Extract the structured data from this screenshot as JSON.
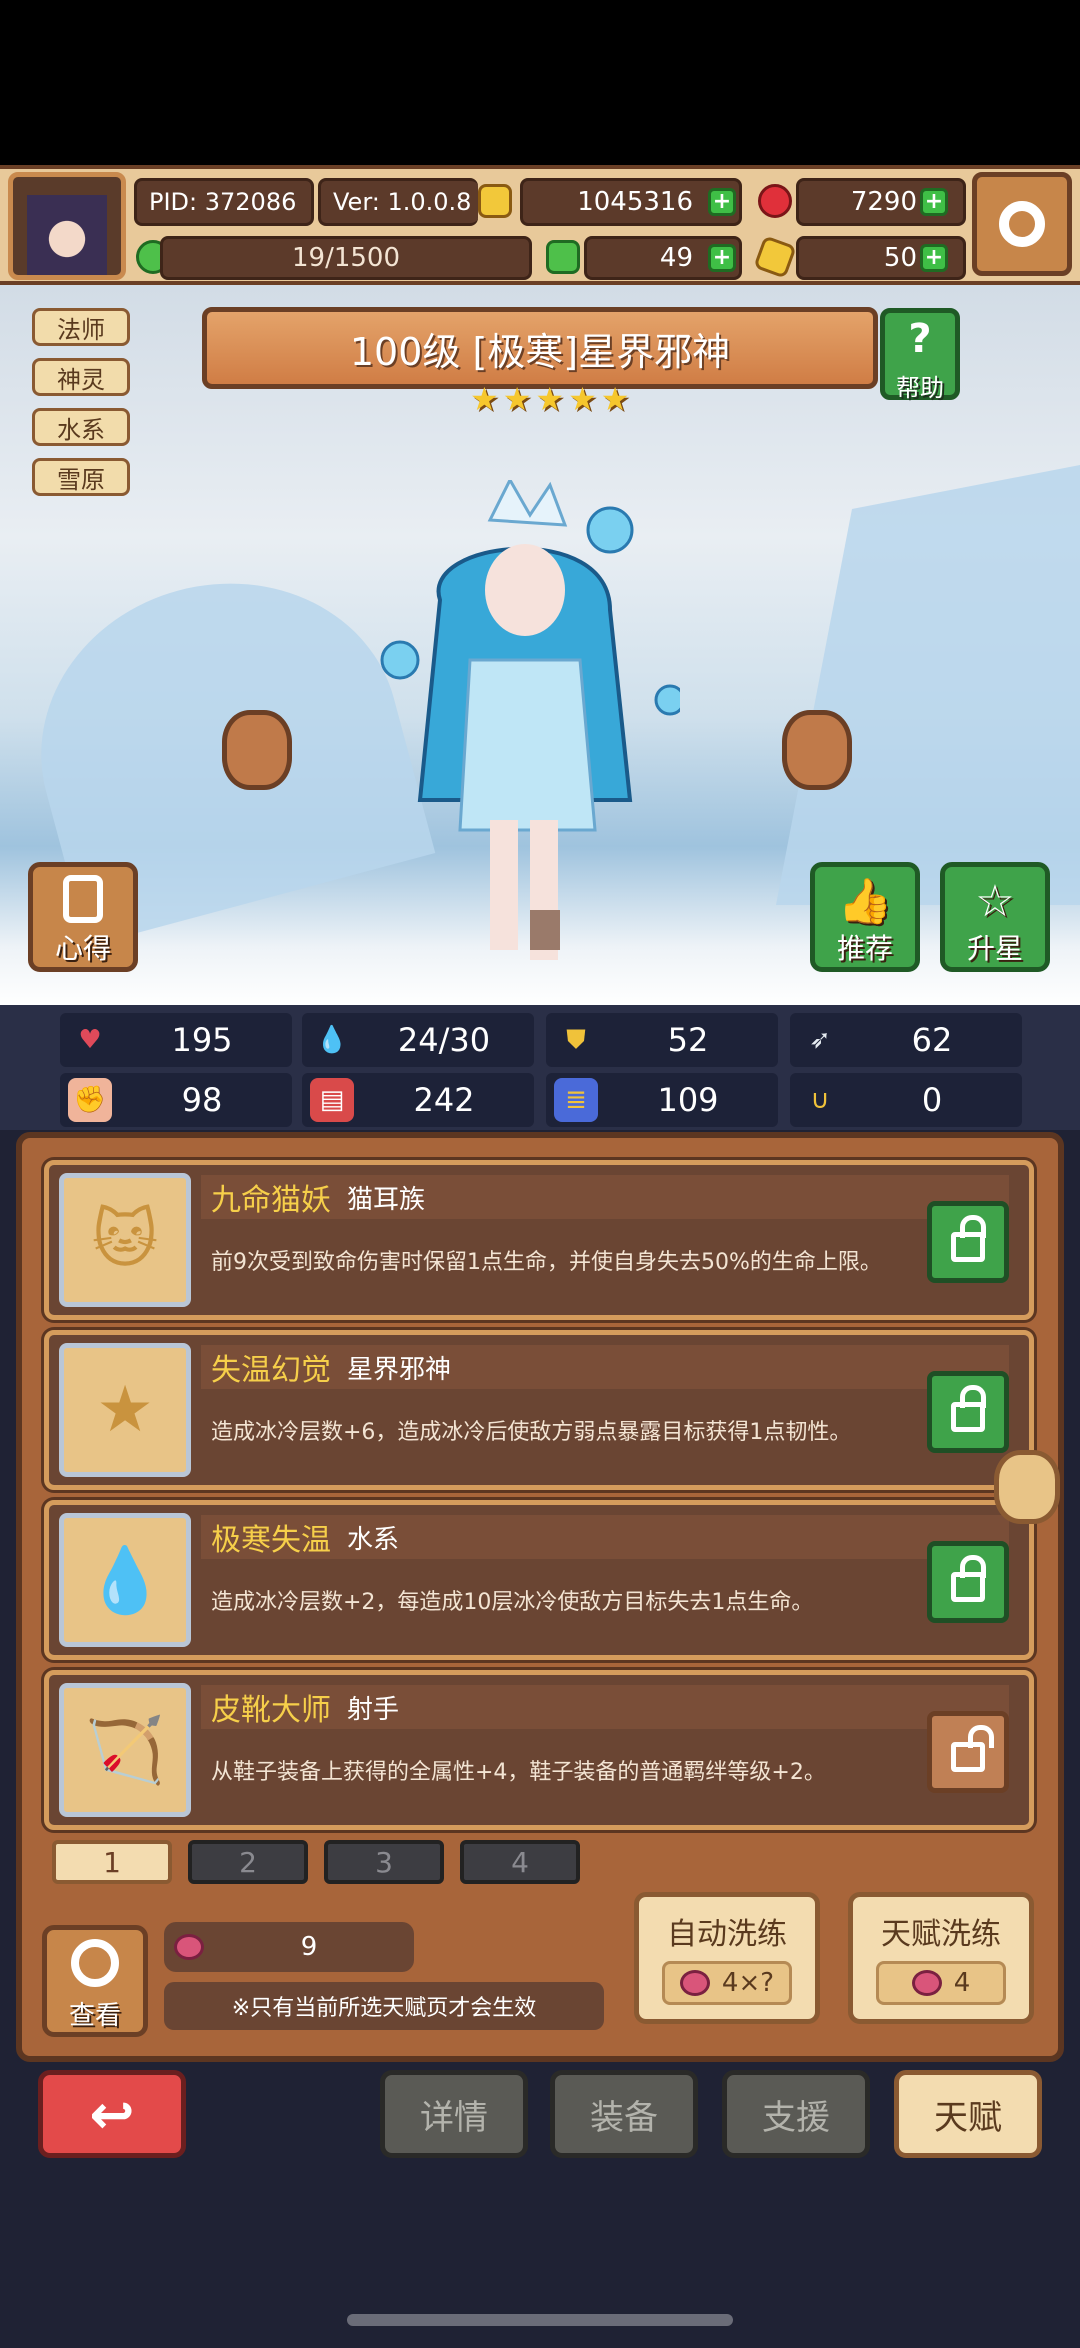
{
  "header": {
    "pid": "PID: 372086",
    "version": "Ver: 1.0.0.8",
    "gold": "1045316",
    "gems": "7290",
    "exp": "19/1500",
    "clover": "49",
    "keys": "50"
  },
  "tags": [
    "法师",
    "神灵",
    "水系",
    "雪原"
  ],
  "hero": {
    "title": "100级 [极寒]星界邪神",
    "stars": 5,
    "help_label": "帮助"
  },
  "scene_buttons": {
    "insight": "心得",
    "recommend": "推荐",
    "star_up": "升星"
  },
  "stats": [
    {
      "icon": "heart-icon",
      "value": "195",
      "color": "#e04a5a"
    },
    {
      "icon": "water-drop-icon",
      "value": "24/30",
      "color": "#4aa8e0"
    },
    {
      "icon": "shield-icon",
      "value": "52",
      "color": "#f0c23a"
    },
    {
      "icon": "wing-icon",
      "value": "62",
      "color": "#e6ecf2"
    },
    {
      "icon": "fist-icon",
      "value": "98",
      "color": "#f0b49a"
    },
    {
      "icon": "book-icon",
      "value": "242",
      "color": "#d94a4a"
    },
    {
      "icon": "scroll-icon",
      "value": "109",
      "color": "#4a6ad9"
    },
    {
      "icon": "horseshoe-icon",
      "value": "0",
      "color": "#f0c23a"
    }
  ],
  "talents": [
    {
      "name": "九命猫妖",
      "sub": "猫耳族",
      "desc": "前9次受到致命伤害时保留1点生命，并使自身失去50%的生命上限。",
      "icon": "cat-icon",
      "locked": true
    },
    {
      "name": "失温幻觉",
      "sub": "星界邪神",
      "desc": "造成冰冷层数+6，造成冰冷后使敌方弱点暴露目标获得1点韧性。",
      "icon": "star-icon",
      "locked": true
    },
    {
      "name": "极寒失温",
      "sub": "水系",
      "desc": "造成冰冷层数+2，每造成10层冰冷使敌方目标失去1点生命。",
      "icon": "water-drop-icon",
      "locked": true
    },
    {
      "name": "皮靴大师",
      "sub": "射手",
      "desc": "从鞋子装备上获得的全属性+4，鞋子装备的普通羁绊等级+2。",
      "icon": "bow-icon",
      "locked": false
    }
  ],
  "pages": [
    "1",
    "2",
    "3",
    "4"
  ],
  "view_label": "查看",
  "fruit_count": "9",
  "note": "※只有当前所选天赋页才会生效",
  "auto_wash": {
    "label": "自动洗练",
    "cost": "4×?"
  },
  "talent_wash": {
    "label": "天赋洗练",
    "cost": "4"
  },
  "bottom_nav": {
    "back": "↩",
    "details": "详情",
    "equip": "装备",
    "support": "支援",
    "talent": "天赋"
  }
}
